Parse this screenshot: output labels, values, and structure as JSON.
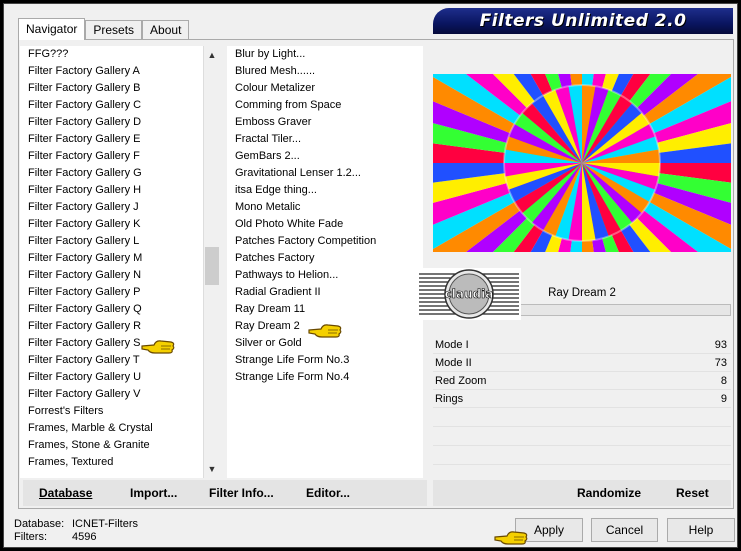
{
  "window": {
    "title": "Filters Unlimited 2.0"
  },
  "tabs": [
    {
      "label": "Navigator",
      "active": true
    },
    {
      "label": "Presets",
      "active": false
    },
    {
      "label": "About",
      "active": false
    }
  ],
  "categories": {
    "items": [
      "FFG???",
      "Filter Factory Gallery A",
      "Filter Factory Gallery B",
      "Filter Factory Gallery C",
      "Filter Factory Gallery D",
      "Filter Factory Gallery E",
      "Filter Factory Gallery F",
      "Filter Factory Gallery G",
      "Filter Factory Gallery H",
      "Filter Factory Gallery J",
      "Filter Factory Gallery K",
      "Filter Factory Gallery L",
      "Filter Factory Gallery M",
      "Filter Factory Gallery N",
      "Filter Factory Gallery P",
      "Filter Factory Gallery Q",
      "Filter Factory Gallery R",
      "Filter Factory Gallery S",
      "Filter Factory Gallery T",
      "Filter Factory Gallery U",
      "Filter Factory Gallery V",
      "Forrest's Filters",
      "Frames, Marble & Crystal",
      "Frames, Stone & Granite",
      "Frames, Textured"
    ],
    "selected": "Filter Factory Gallery S"
  },
  "filters": {
    "items": [
      "Blur by Light...",
      "Blured Mesh......",
      "Colour Metalizer",
      "Comming from Space",
      "Emboss Graver",
      "Fractal Tiler...",
      "GemBars 2...",
      "Gravitational Lenser 1.2...",
      "itsa Edge thing...",
      "Mono Metalic",
      "Old Photo White Fade",
      "Patches Factory Competition",
      "Patches Factory",
      "Pathways to Helion...",
      "Radial Gradient II",
      "Ray Dream 11",
      "Ray Dream 2",
      "Silver or Gold",
      "Strange Life Form No.3",
      "Strange Life Form No.4"
    ],
    "selected": "Ray Dream 2"
  },
  "selected_filter_name": "Ray Dream 2",
  "logo_text": "claudia",
  "params": [
    {
      "label": "Mode I",
      "value": "93"
    },
    {
      "label": "Mode II",
      "value": "73"
    },
    {
      "label": "Red Zoom",
      "value": "8"
    },
    {
      "label": "Rings",
      "value": "9"
    }
  ],
  "left_buttons": {
    "database": "Database",
    "import": "Import...",
    "filter_info": "Filter Info...",
    "editor": "Editor..."
  },
  "right_buttons": {
    "randomize": "Randomize",
    "reset": "Reset"
  },
  "status": {
    "database_label": "Database:",
    "database_value": "ICNET-Filters",
    "filters_label": "Filters:",
    "filters_value": "4596"
  },
  "dialog_buttons": {
    "apply": "Apply",
    "cancel": "Cancel",
    "help": "Help"
  },
  "colors": {
    "banner": "#0a1560",
    "hand": "#f5d000"
  }
}
